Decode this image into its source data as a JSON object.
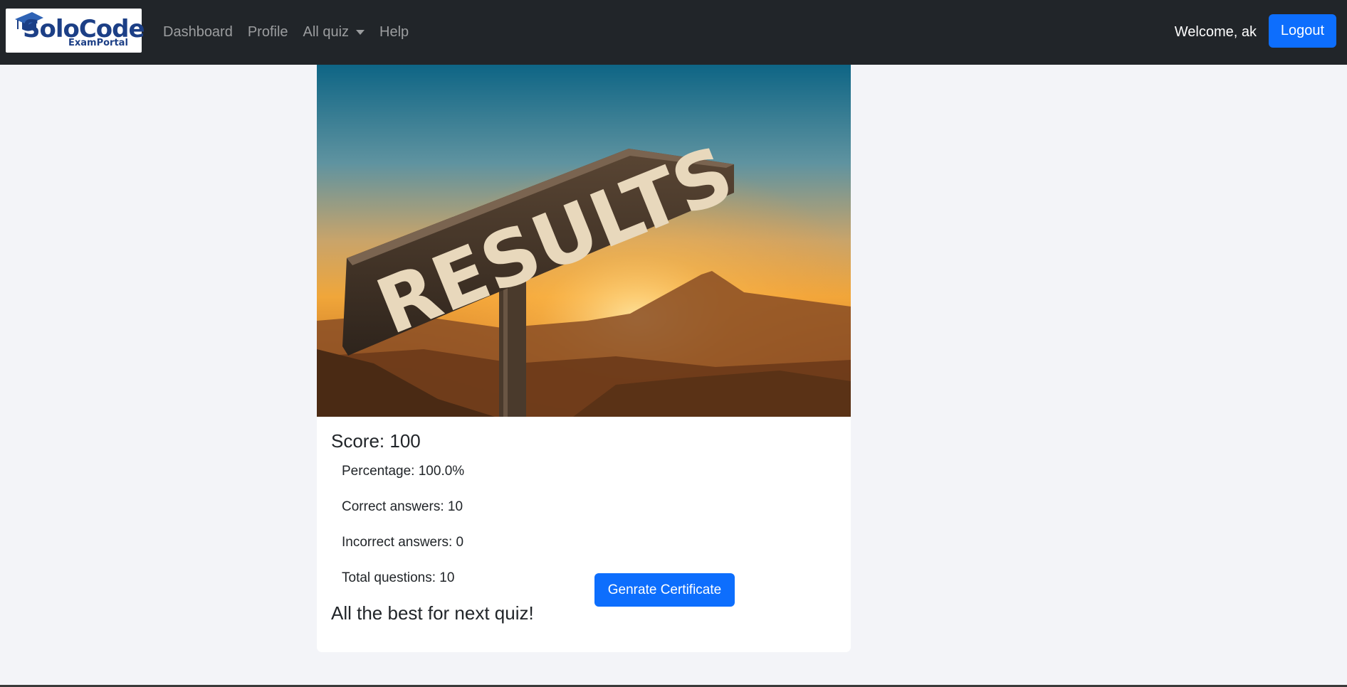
{
  "brand": {
    "name": "SoloCode",
    "sub": "ExamPortal"
  },
  "nav": {
    "links": [
      "Dashboard",
      "Profile",
      "All quiz",
      "Help"
    ],
    "welcome": "Welcome, ak",
    "logout_label": "Logout"
  },
  "hero": {
    "sign_text": "RESULTS"
  },
  "result": {
    "score": "Score: 100",
    "percentage": "Percentage: 100.0%",
    "correct": "Correct answers: 10",
    "incorrect": "Incorrect answers: 0",
    "total": "Total questions: 10",
    "message": "All the best for next quiz!",
    "certificate_label": "Genrate Certificate"
  },
  "colors": {
    "navbar": "#212529",
    "primary": "#0d6efd",
    "background": "#f3f4f8",
    "brand": "#1c3f86"
  },
  "icons": {
    "brand_logo": "graduation-cap-icon",
    "dropdown": "caret-down-icon"
  }
}
